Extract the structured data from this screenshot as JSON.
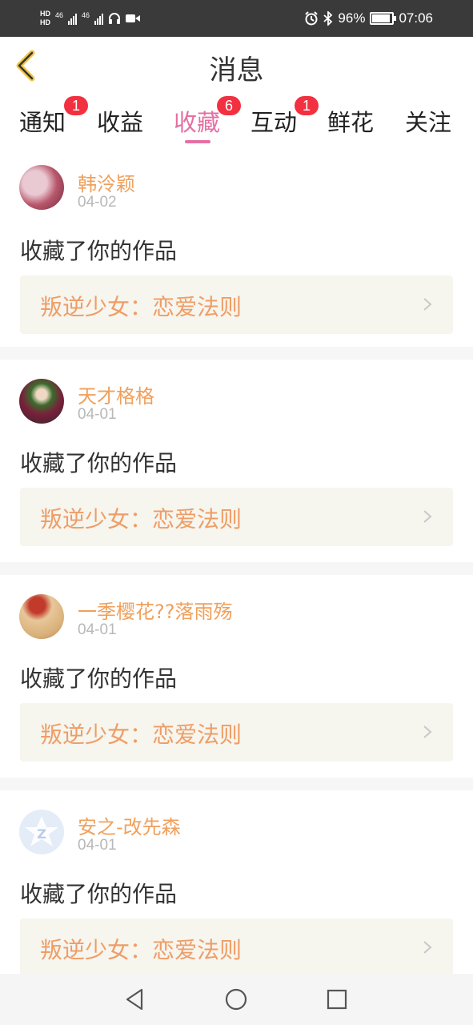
{
  "status_bar": {
    "hd1": "HD",
    "hd2": "HD",
    "net1": "46",
    "net2": "46",
    "battery_text": "96%",
    "battery_level": 0.96,
    "time": "07:06"
  },
  "header": {
    "title": "消息"
  },
  "tabs": [
    {
      "label": "通知",
      "badge": "1"
    },
    {
      "label": "收益",
      "badge": ""
    },
    {
      "label": "收藏",
      "badge": "6",
      "active": true
    },
    {
      "label": "互动",
      "badge": "1"
    },
    {
      "label": "鲜花",
      "badge": ""
    },
    {
      "label": "关注",
      "badge": ""
    }
  ],
  "messages": [
    {
      "name": "韩泠颖",
      "date": "04-02",
      "action": "收藏了你的作品",
      "work": "叛逆少女：恋爱法则"
    },
    {
      "name": "天才格格",
      "date": "04-01",
      "action": "收藏了你的作品",
      "work": "叛逆少女：恋爱法则"
    },
    {
      "name": "一季樱花??落雨殇",
      "date": "04-01",
      "action": "收藏了你的作品",
      "work": "叛逆少女：恋爱法则"
    },
    {
      "name": "安之-改先森",
      "date": "04-01",
      "action": "收藏了你的作品",
      "work": "叛逆少女：恋爱法则"
    }
  ],
  "colors": {
    "accent": "#e56fa3",
    "badge": "#f2303f",
    "username": "#f0a05c",
    "work_title": "#ef9d66"
  },
  "icons": [
    "back-icon",
    "chevron-right-icon",
    "nav-back-icon",
    "nav-home-icon",
    "nav-recents-icon",
    "alarm-icon",
    "bluetooth-icon",
    "headset-icon",
    "video-icon"
  ]
}
